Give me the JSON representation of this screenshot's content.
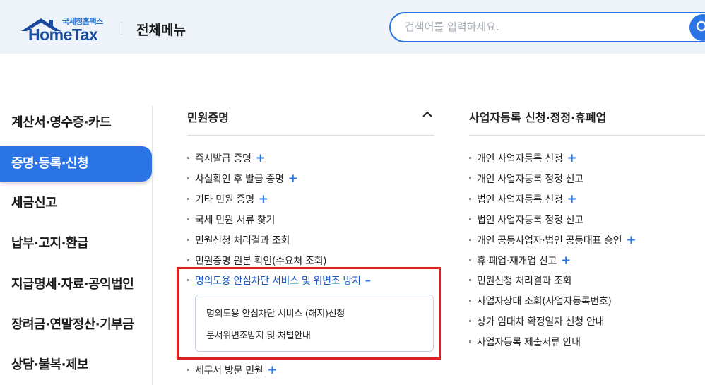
{
  "header": {
    "logo_sub": "국세청홈택스",
    "logo_main": "HomeTax",
    "menu_title": "전체메뉴",
    "search_placeholder": "검색어를 입력하세요."
  },
  "nav": [
    {
      "label": "계산서·영수증·카드",
      "active": false
    },
    {
      "label": "증명·등록·신청",
      "active": true
    },
    {
      "label": "세금신고",
      "active": false
    },
    {
      "label": "납부·고지·환급",
      "active": false
    },
    {
      "label": "지급명세·자료·공익법인",
      "active": false
    },
    {
      "label": "장려금·연말정산·기부금",
      "active": false
    },
    {
      "label": "상담·불복·제보",
      "active": false
    }
  ],
  "col1": {
    "title": "민원증명",
    "items": [
      {
        "label": "즉시발급 증명",
        "icon": "plus"
      },
      {
        "label": "사실확인 후 발급 증명",
        "icon": "plus"
      },
      {
        "label": "기타 민원 증명",
        "icon": "plus"
      },
      {
        "label": "국세 민원 서류 찾기",
        "icon": ""
      },
      {
        "label": "민원신청 처리결과 조회",
        "icon": ""
      },
      {
        "label": "민원증명 원본 확인(수요처 조회)",
        "icon": ""
      },
      {
        "label": "명의도용 안심차단 서비스 및 위변조 방지",
        "icon": "minus"
      }
    ],
    "subitems": [
      "명의도용 안심차단 서비스 (해지)신청",
      "문서위변조방지 및 처벌안내"
    ],
    "last_item": {
      "label": "세무서 방문 민원",
      "icon": "plus"
    }
  },
  "col2": {
    "title": "사업자등록 신청·정정·휴폐업",
    "items": [
      {
        "label": "개인 사업자등록 신청",
        "icon": "plus"
      },
      {
        "label": "개인 사업자등록 정정 신고",
        "icon": ""
      },
      {
        "label": "법인 사업자등록 신청",
        "icon": "plus"
      },
      {
        "label": "법인 사업자등록 정정 신고",
        "icon": ""
      },
      {
        "label": "개인 공동사업자·법인 공동대표 승인",
        "icon": "plus"
      },
      {
        "label": "휴·폐업·재개업 신고",
        "icon": "plus"
      },
      {
        "label": "민원신청 처리결과 조회",
        "icon": ""
      },
      {
        "label": "사업자상태 조회(사업자등록번호)",
        "icon": ""
      },
      {
        "label": "상가 임대차 확정일자 신청 안내",
        "icon": ""
      },
      {
        "label": "사업자등록 제출서류 안내",
        "icon": ""
      }
    ]
  },
  "colors": {
    "accent": "#2a74e6",
    "highlight_border": "#e0201c",
    "header_bg": "#eef2f9"
  }
}
